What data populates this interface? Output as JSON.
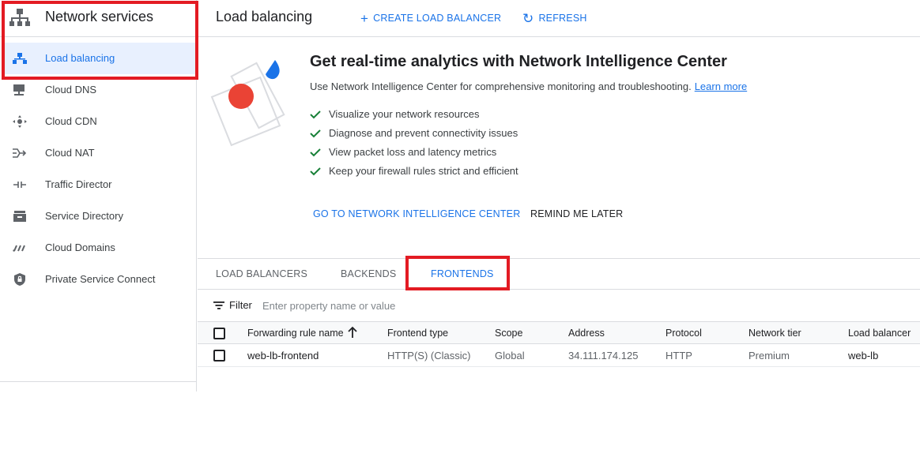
{
  "sidebar": {
    "title": "Network services",
    "items": [
      {
        "label": "Load balancing",
        "icon": "load-balancing-icon"
      },
      {
        "label": "Cloud DNS",
        "icon": "cloud-dns-icon"
      },
      {
        "label": "Cloud CDN",
        "icon": "cloud-cdn-icon"
      },
      {
        "label": "Cloud NAT",
        "icon": "cloud-nat-icon"
      },
      {
        "label": "Traffic Director",
        "icon": "traffic-director-icon"
      },
      {
        "label": "Service Directory",
        "icon": "service-directory-icon"
      },
      {
        "label": "Cloud Domains",
        "icon": "cloud-domains-icon"
      },
      {
        "label": "Private Service Connect",
        "icon": "private-service-connect-icon"
      }
    ]
  },
  "topbar": {
    "title": "Load balancing",
    "create_label": "CREATE LOAD BALANCER",
    "refresh_label": "REFRESH"
  },
  "banner": {
    "headline": "Get real-time analytics with Network Intelligence Center",
    "description": "Use Network Intelligence Center for comprehensive monitoring and troubleshooting.",
    "learn_more": "Learn more",
    "checks": [
      "Visualize your network resources",
      "Diagnose and prevent connectivity issues",
      "View packet loss and latency metrics",
      "Keep your firewall rules strict and efficient"
    ],
    "primary_action": "GO TO NETWORK INTELLIGENCE CENTER",
    "secondary_action": "REMIND ME LATER"
  },
  "tabs": {
    "items": [
      "LOAD BALANCERS",
      "BACKENDS",
      "FRONTENDS"
    ],
    "active": "FRONTENDS"
  },
  "filter": {
    "label": "Filter",
    "placeholder": "Enter property name or value"
  },
  "table": {
    "columns": [
      "Forwarding rule name",
      "Frontend type",
      "Scope",
      "Address",
      "Protocol",
      "Network tier",
      "Load balancer"
    ],
    "rows": [
      [
        "web-lb-frontend",
        "HTTP(S) (Classic)",
        "Global",
        "34.111.174.125",
        "HTTP",
        "Premium",
        "web-lb"
      ]
    ]
  },
  "colors": {
    "accent": "#1a73e8",
    "highlight": "#e31b23",
    "check": "#188038"
  }
}
